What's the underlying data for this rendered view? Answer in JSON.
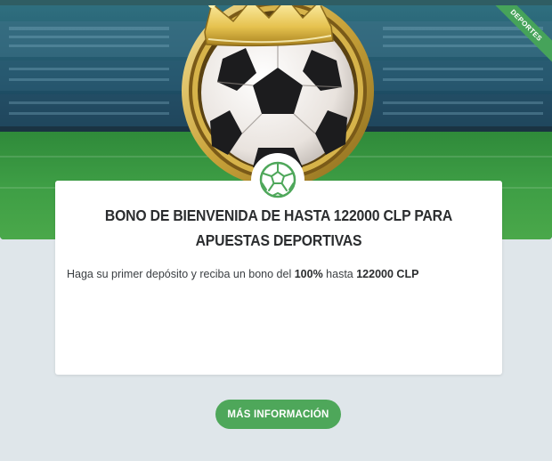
{
  "ribbon": {
    "label": "DEPORTES"
  },
  "card": {
    "title": "BONO DE BIENVENIDA DE HASTA 122000 CLP PARA APUESTAS DEPORTIVAS",
    "desc_prefix": "Haga su primer depósito y reciba un bono del ",
    "desc_percent": "100%",
    "desc_middle": " hasta ",
    "desc_amount": "122000 CLP"
  },
  "cta": {
    "label": "MÁS INFORMACIÓN"
  },
  "icons": {
    "hero": "soccer-ball-crown-icon",
    "badge": "soccer-ball-icon"
  },
  "colors": {
    "accent_green": "#4ea75a",
    "ribbon_green": "#46a35a",
    "background": "#dfe6ea",
    "title_text": "#2b2d2f"
  }
}
